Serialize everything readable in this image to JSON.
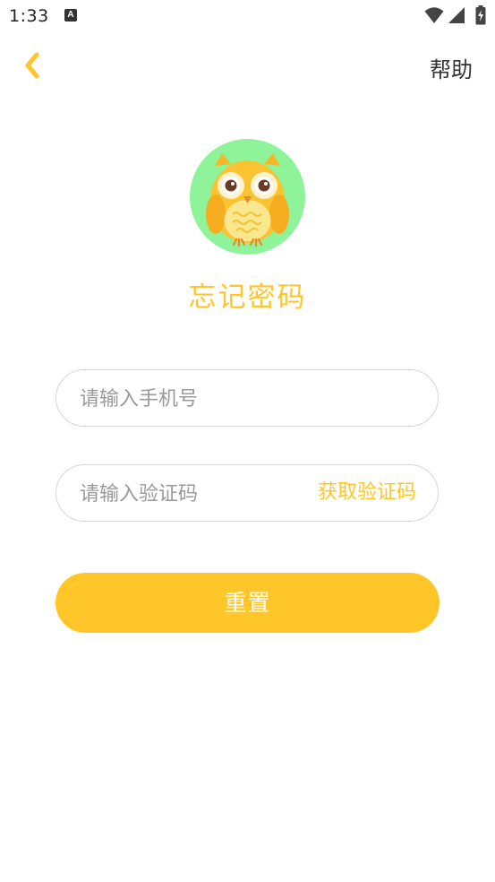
{
  "status_bar": {
    "time": "1:33",
    "notification_icon": "a-notification-icon",
    "notification_glyph": "A",
    "icons": [
      "wifi-icon",
      "signal-icon",
      "battery-charging-icon"
    ]
  },
  "nav": {
    "back_icon": "chevron-left-icon",
    "help_label": "帮助"
  },
  "avatar": {
    "icon": "owl-avatar-icon"
  },
  "page": {
    "title": "忘记密码"
  },
  "form": {
    "phone_placeholder": "请输入手机号",
    "phone_value": "",
    "code_placeholder": "请输入验证码",
    "code_value": "",
    "get_code_label": "获取验证码",
    "submit_label": "重置"
  },
  "colors": {
    "accent": "#ffc629",
    "avatar_background": "#8ff39a",
    "placeholder": "#9a9a9a",
    "border": "#d6d6d6"
  }
}
